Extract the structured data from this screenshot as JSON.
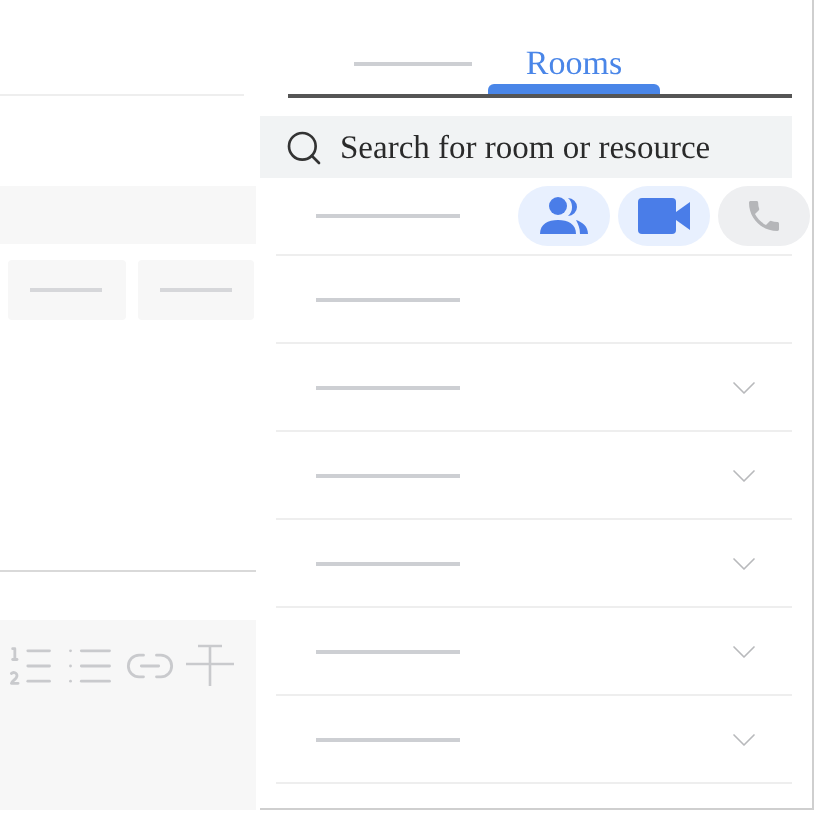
{
  "tabs": [
    {
      "kind": "skeleton",
      "selected": false
    },
    {
      "kind": "text",
      "label": "Rooms",
      "selected": true
    }
  ],
  "search": {
    "placeholder": "Search for room or resource"
  },
  "resource_filters": [
    {
      "kind": "people",
      "selected": true
    },
    {
      "kind": "video",
      "selected": true
    },
    {
      "kind": "phone",
      "selected": false
    }
  ],
  "rows": [
    {
      "expandable": false
    },
    {
      "expandable": false
    },
    {
      "expandable": true
    },
    {
      "expandable": true
    },
    {
      "expandable": true
    },
    {
      "expandable": true
    },
    {
      "expandable": true
    }
  ]
}
